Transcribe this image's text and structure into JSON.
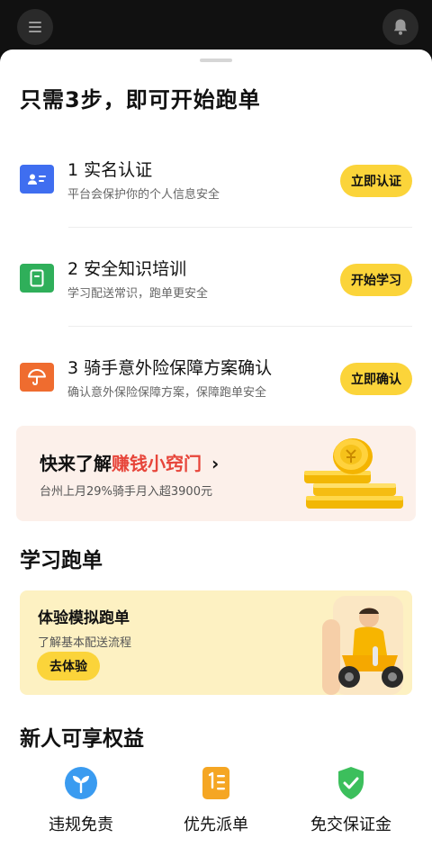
{
  "topbar": {
    "menu_icon": "menu-icon",
    "bell_icon": "bell-icon"
  },
  "sheet": {
    "title": "只需3步，即可开始跑单"
  },
  "steps": [
    {
      "title": "1 实名认证",
      "subtitle": "平台会保护你的个人信息安全",
      "button": "立即认证",
      "icon": "id-card-icon",
      "color": "#3f6ef0"
    },
    {
      "title": "2 安全知识培训",
      "subtitle": "学习配送常识，跑单更安全",
      "button": "开始学习",
      "icon": "book-icon",
      "color": "#2faf5a"
    },
    {
      "title": "3 骑手意外险保障方案确认",
      "subtitle": "确认意外保险保障方案，保障跑单安全",
      "button": "立即确认",
      "icon": "umbrella-icon",
      "color": "#ef6c2f"
    }
  ],
  "promo": {
    "title_prefix": "快来了解",
    "title_highlight": "赚钱小窍门",
    "arrow": "›",
    "subtitle": "台州上月29%骑手月入超3900元",
    "icon": "gold-coins-icon"
  },
  "learn": {
    "section_title": "学习跑单",
    "card_title": "体验模拟跑单",
    "card_subtitle": "了解基本配送流程",
    "button": "去体验",
    "image": "rider-scooter-illustration"
  },
  "benefits": {
    "section_title": "新人可享权益",
    "items": [
      {
        "label": "违规免责",
        "icon": "sprout-icon",
        "color": "#3a9bf0"
      },
      {
        "label": "优先派单",
        "icon": "priority-list-icon",
        "color": "#f5a623"
      },
      {
        "label": "免交保证金",
        "icon": "shield-check-icon",
        "color": "#3cbf5c"
      }
    ]
  },
  "colors": {
    "accent_yellow": "#fbd43a",
    "highlight_red": "#e7453a",
    "promo_bg": "#fcf0ea",
    "learn_bg": "#fdf1c2"
  }
}
